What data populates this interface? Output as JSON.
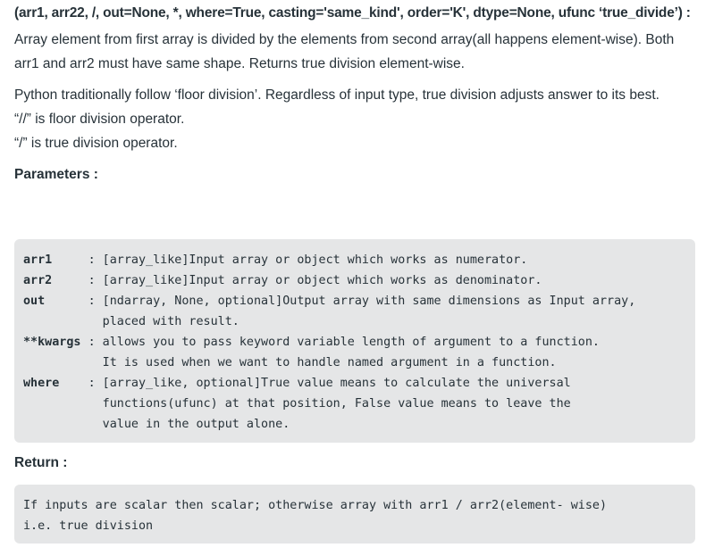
{
  "signature": "(arr1, arr22, /, out=None, *, where=True, casting='same_kind', order='K', dtype=None, ufunc ‘true_divide’) :",
  "description": "Array element from first array is divided by the elements from second array(all happens element-wise). Both arr1 and arr2 must have same shape. Returns true division element-wise.",
  "notes": {
    "line1": "Python traditionally follow ‘floor division’. Regardless of input type, true division adjusts answer to its best.",
    "line2": "“//” is floor division operator.",
    "line3": "“/” is true division operator."
  },
  "parameters_heading": "Parameters :",
  "parameters_code": [
    {
      "key": "arr1     ",
      "text": ": [array_like]Input array or object which works as numerator."
    },
    {
      "key": "arr2     ",
      "text": ": [array_like]Input array or object which works as denominator."
    },
    {
      "key": "out      ",
      "text": ": [ndarray, None, optional]Output array with same dimensions as Input array,"
    },
    {
      "key": "         ",
      "text": "  placed with result."
    },
    {
      "key": "**kwargs ",
      "text": ": allows you to pass keyword variable length of argument to a function."
    },
    {
      "key": "         ",
      "text": "  It is used when we want to handle named argument in a function."
    },
    {
      "key": "where    ",
      "text": ": [array_like, optional]True value means to calculate the universal"
    },
    {
      "key": "         ",
      "text": "  functions(ufunc) at that position, False value means to leave the"
    },
    {
      "key": "         ",
      "text": "  value in the output alone."
    }
  ],
  "return_heading": "Return :",
  "return_code": [
    "If inputs are scalar then scalar; otherwise array with arr1 / arr2(element- wise)",
    "i.e. true division"
  ]
}
